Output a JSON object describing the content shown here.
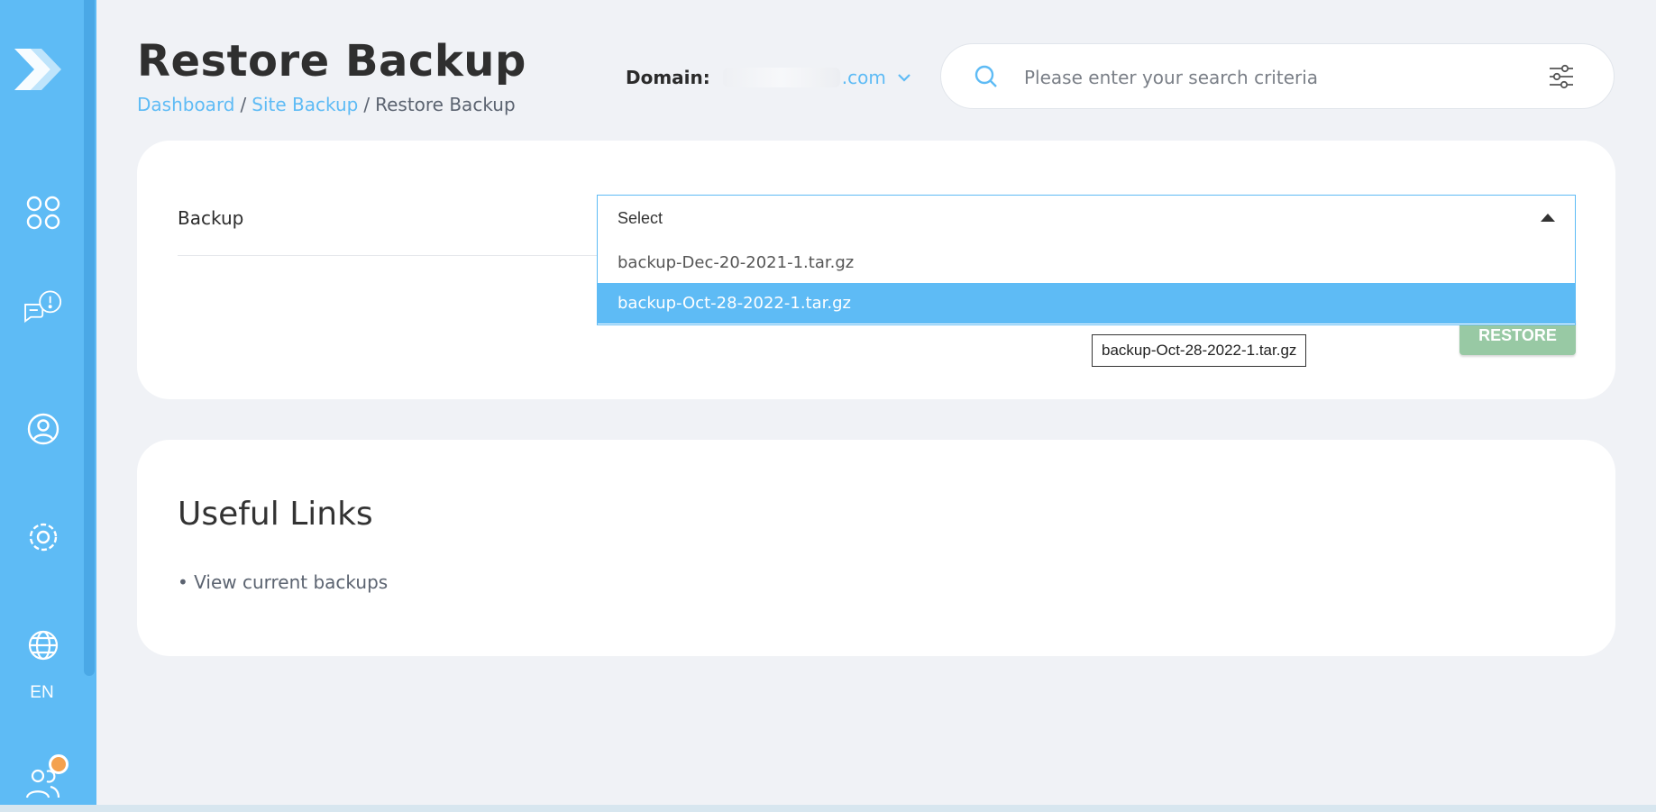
{
  "sidebar": {
    "logo_icon": "brand-arrow-logo",
    "items": [
      {
        "name": "dashboard-grid-icon"
      },
      {
        "name": "support-chat-alert-icon"
      },
      {
        "name": "user-account-icon"
      },
      {
        "name": "settings-gear-icon"
      },
      {
        "name": "language-globe-icon"
      },
      {
        "name": "users-notification-icon"
      }
    ],
    "language": "EN",
    "accent": "#5ebbf5",
    "notification_color": "#f4a14e"
  },
  "header": {
    "title": "Restore Backup",
    "breadcrumb": {
      "crumb1": "Dashboard",
      "sep": "/",
      "crumb2": "Site Backup",
      "current": "Restore Backup"
    },
    "domain": {
      "label": "Domain:",
      "suffix": ".com"
    },
    "search": {
      "placeholder": "Please enter your search criteria"
    }
  },
  "backup_form": {
    "label": "Backup",
    "select": {
      "value": "Select",
      "options": [
        "backup-Dec-20-2021-1.tar.gz",
        "backup-Oct-28-2022-1.tar.gz"
      ],
      "highlighted": "backup-Oct-28-2022-1.tar.gz"
    },
    "restore_label": "RESTORE",
    "tooltip": "backup-Oct-28-2022-1.tar.gz",
    "restore_color": "#98c9a4"
  },
  "useful_links": {
    "title": "Useful Links",
    "items": [
      "• View current backups"
    ]
  }
}
